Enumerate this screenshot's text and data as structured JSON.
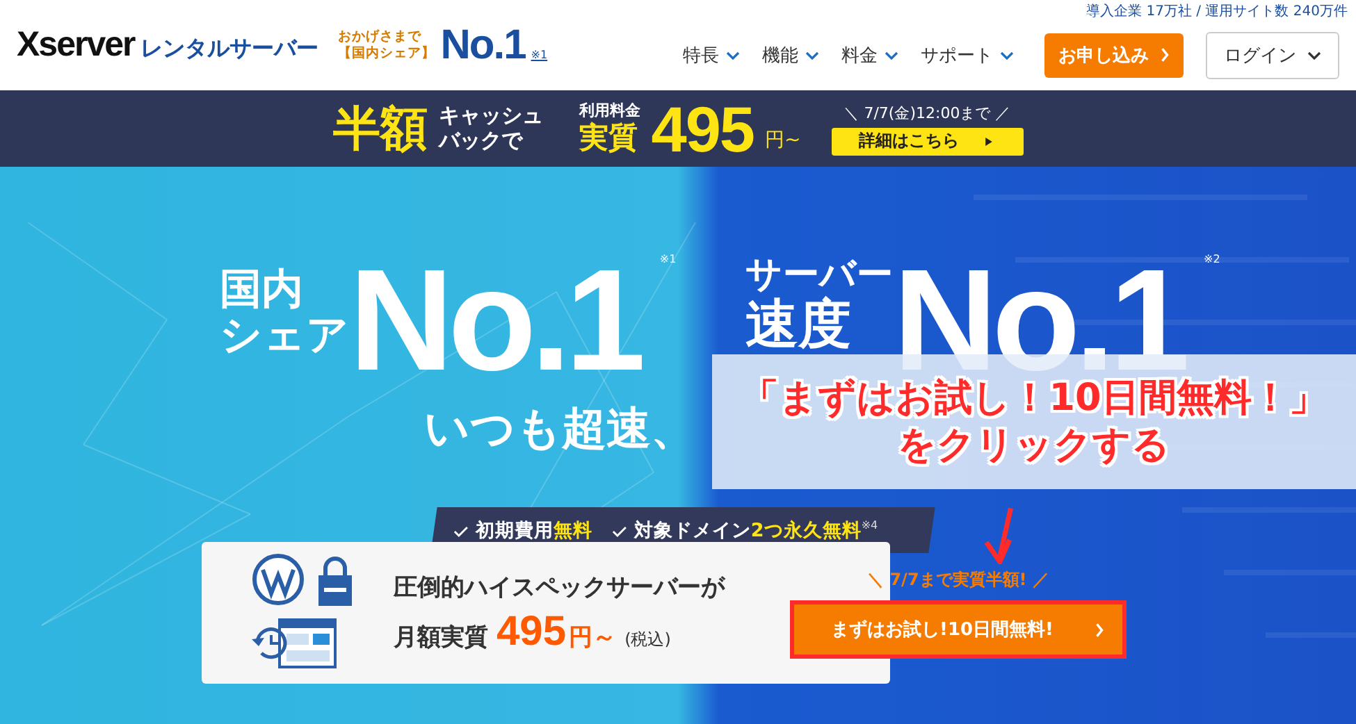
{
  "header": {
    "logo_brand": "Xserver",
    "logo_sub": "レンタルサーバー",
    "award_lines": [
      "おかげさまで",
      "【国内シェア】"
    ],
    "award_big": "No.1",
    "award_note": "※1",
    "stats": "導入企業 17万社 / 運用サイト数 240万件",
    "nav": [
      {
        "label": "特長"
      },
      {
        "label": "機能"
      },
      {
        "label": "料金"
      },
      {
        "label": "サポート"
      }
    ],
    "apply_button": "お申し込み",
    "login_button": "ログイン"
  },
  "banner": {
    "headline": "半額",
    "sub_lines": [
      "キャッシュ",
      "バックで"
    ],
    "price_label": "利用料金",
    "price_prefix": "実質",
    "price": "495",
    "price_unit": "円~",
    "deadline": "＼ 7/7(金)12:00まで ／",
    "details_button": "詳細はこちら"
  },
  "hero": {
    "claims": [
      {
        "label_lines": [
          "国内",
          "シェア"
        ],
        "big": "No.1",
        "note": "※1"
      },
      {
        "label_lines": [
          "サーバー",
          "速度"
        ],
        "big": "No.1",
        "note": "※2"
      }
    ],
    "tagline": "いつも超速、",
    "features": [
      "初期費用**無料**",
      "対象ドメイン**2つ永久無料**$^{※4}$"
    ],
    "card": {
      "line1": "圧倒的ハイスペックサーバーが",
      "line2_prefix": "月額実質",
      "price": "495",
      "price_unit": "円～",
      "tax": "(税込)",
      "promo": "＼ 7/7まで実質半額! ／",
      "cta": "まずはお試し!10日間無料!"
    }
  },
  "annotation": {
    "lines": [
      "「まずはお試し！10日間無料！」",
      "をクリックする"
    ]
  }
}
